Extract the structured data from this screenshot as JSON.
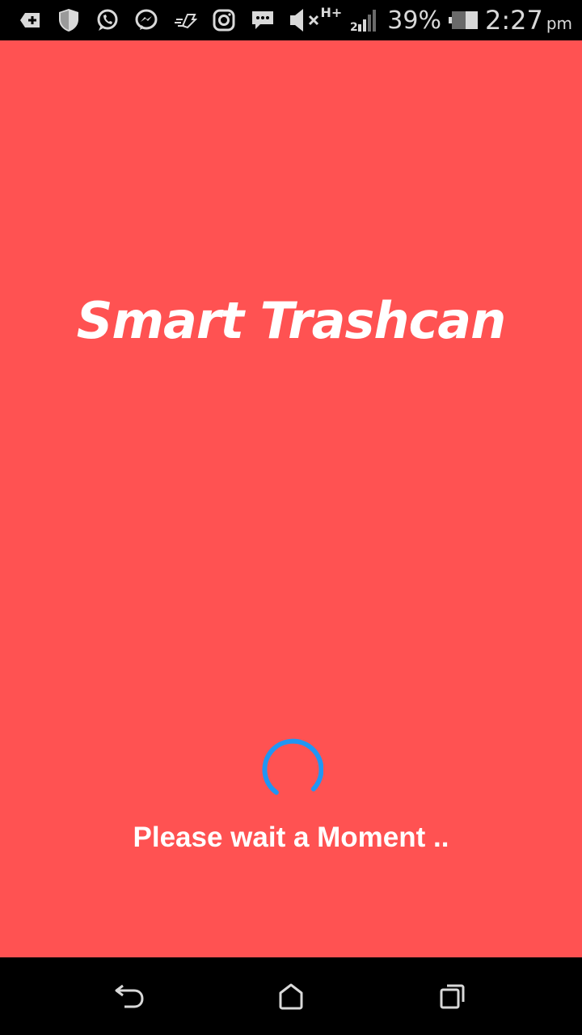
{
  "status_bar": {
    "icons": [
      "add-notification-icon",
      "shield-icon",
      "whatsapp-icon",
      "messenger-icon",
      "speed-icon",
      "instagram-icon",
      "chat-icon",
      "mute-icon"
    ],
    "network_type": "H+",
    "signal_label": "2",
    "battery_percent": "39%",
    "time": "2:27",
    "ampm": "pm"
  },
  "app": {
    "background_color": "#ff5252",
    "title": "Smart Trashcan",
    "loading_text": "Please wait a Moment ..",
    "spinner_color": "#2196f3"
  },
  "nav_bar": {
    "buttons": [
      "back-icon",
      "home-icon",
      "recents-icon"
    ]
  }
}
